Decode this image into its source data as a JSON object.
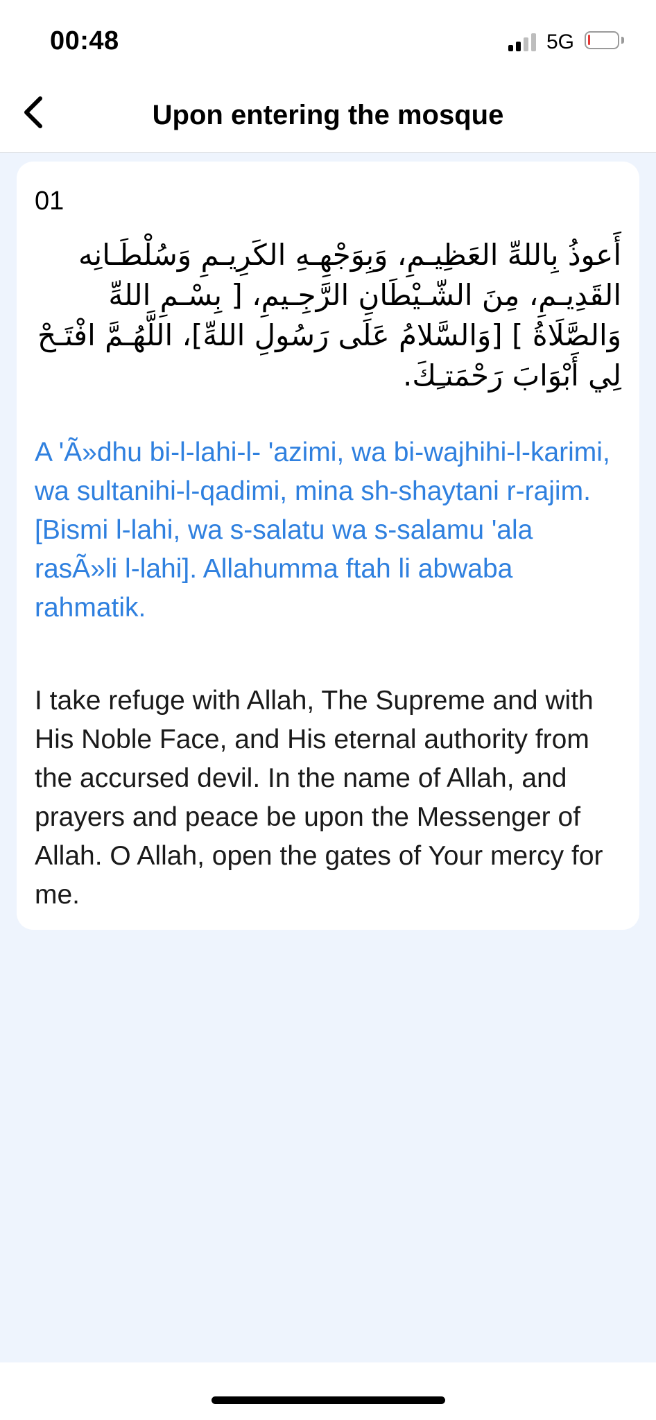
{
  "status_bar": {
    "time": "00:48",
    "network": "5G",
    "battery_level": 0.08,
    "battery_color": "#e53935"
  },
  "nav": {
    "title": "Upon entering the mosque",
    "back_icon": "chevron-left-icon"
  },
  "dua": {
    "number": "01",
    "arabic": "أَعوذُ بِاللهِّ العَظِيـمِ، وَبِوَجْهِـهِ الكَرِيـمِ وَسُلْطَـانِه القَدِيـمِ، مِنَ الشّـيْطَانِ الرَّجِـيمِ، [ بِسْـمِ اللهِّ وَالصَّلَاةُ ] [وَالسَّلامُ عَلَى رَسُولِ اللهِّ]، اللَّهُـمَّ افْتَـحْ لِي أَبْوَابَ رَحْمَتـِكَ.",
    "transliteration_line1": "A 'Ã»dhu bi-l-lahi-l- 'azimi, wa bi-wajhihi-l-karimi, wa sultanihi-l-qadimi, mina sh-shaytani r-rajim.",
    "transliteration_line2": "[Bismi l-lahi, wa s-salatu wa s-salamu 'ala rasÃ»li l-lahi]. Allahumma ftah li abwaba rahmatik.",
    "translation": "I take refuge with Allah, The Supreme and with His Noble Face, and His eternal authority from the accursed devil. In the name of Allah, and prayers and peace be upon the Messenger of Allah. O Allah, open the gates of Your mercy for me."
  },
  "colors": {
    "accent": "#2f80df",
    "background": "#eef4fd"
  }
}
